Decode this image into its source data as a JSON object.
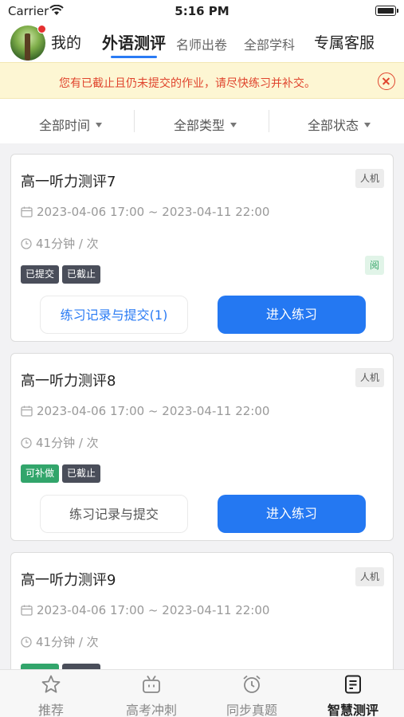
{
  "status_bar": {
    "carrier": "Carrier",
    "time": "5:16 PM"
  },
  "top_nav": {
    "tabs": [
      {
        "label": "我的"
      },
      {
        "label": "外语测评"
      },
      {
        "label": "名师出卷"
      },
      {
        "label": "全部学科"
      },
      {
        "label": "专属客服"
      }
    ]
  },
  "notice": {
    "text": "您有已截止且仍未提交的作业，请尽快练习并补交。"
  },
  "filters": [
    {
      "label": "全部时间"
    },
    {
      "label": "全部类型"
    },
    {
      "label": "全部状态"
    }
  ],
  "cards": [
    {
      "title": "高一听力测评7",
      "mode": "人机",
      "time_range": "2023-04-06 17:00 ~ 2023-04-11 22:00",
      "duration": "41分钟 / 次",
      "badges": [
        "已提交",
        "已截止"
      ],
      "read_tag": "阅",
      "record_button": "练习记录与提交(1)",
      "enter_button": "进入练习"
    },
    {
      "title": "高一听力测评8",
      "mode": "人机",
      "time_range": "2023-04-06 17:00 ~ 2023-04-11 22:00",
      "duration": "41分钟 / 次",
      "badges": [
        "可补做",
        "已截止"
      ],
      "record_button": "练习记录与提交",
      "enter_button": "进入练习"
    },
    {
      "title": "高一听力测评9",
      "mode": "人机",
      "time_range": "2023-04-06 17:00 ~ 2023-04-11 22:00",
      "duration": "41分钟 / 次",
      "badges": [
        "",
        ""
      ]
    }
  ],
  "tab_bar": [
    {
      "label": "推荐",
      "icon": "star-icon"
    },
    {
      "label": "高考冲刺",
      "icon": "tv-icon"
    },
    {
      "label": "同步真题",
      "icon": "alarm-clock-icon"
    },
    {
      "label": "智慧测评",
      "icon": "document-icon"
    }
  ],
  "colors": {
    "accent": "#2478f2",
    "alert": "#e0452e",
    "badge_dark": "#4a4e5a",
    "badge_green": "#32a56b"
  }
}
